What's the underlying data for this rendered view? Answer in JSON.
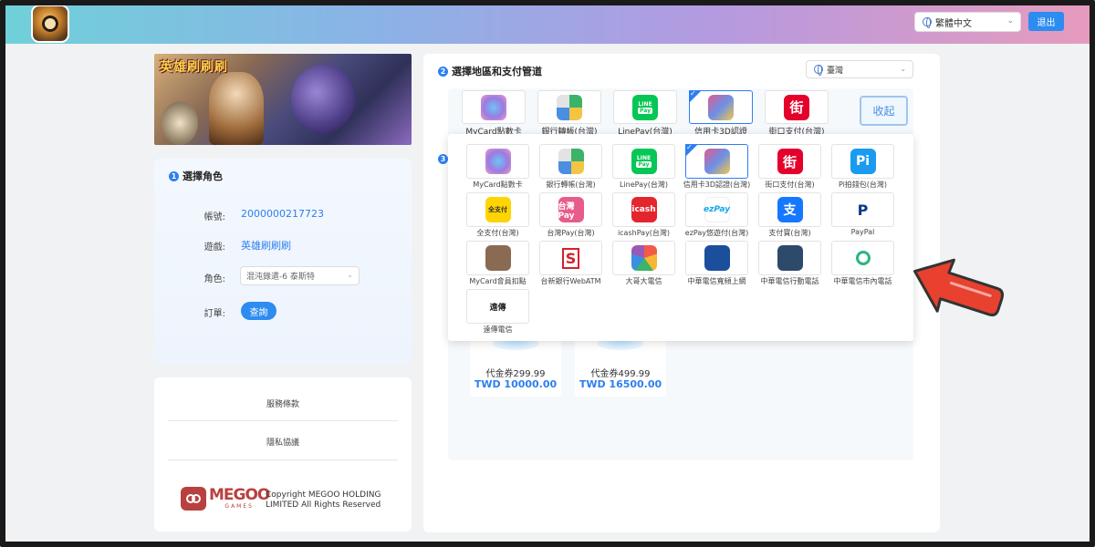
{
  "header": {
    "language": "繁體中文",
    "logout_label": "退出"
  },
  "banner": {
    "title": "英雄刷刷刷"
  },
  "role_section": {
    "step": "1",
    "title": "選擇角色",
    "account_label": "帳號:",
    "account_value": "2000000217723",
    "game_label": "遊戲:",
    "game_value": "英雄刷刷刷",
    "role_label": "角色:",
    "role_value": "混沌錄遣-6 泰斯特",
    "order_label": "訂單:",
    "query_label": "查詢"
  },
  "info": {
    "terms_label": "服務條款",
    "privacy_label": "隱私協議",
    "brand": "MEGOO",
    "brand_sub": "GAMES",
    "copyright": "Copyright MEGOO HOLDING LIMITED All Rights Reserved"
  },
  "payment_section": {
    "step": "2",
    "title": "選擇地區和支付管道",
    "region": "臺灣",
    "collapse_label": "收起",
    "step3": "3",
    "top_row": [
      {
        "label": "MyCard點數卡",
        "icon": "mycard-icon"
      },
      {
        "label": "銀行轉帳(台灣)",
        "icon": "bank-transfer-icon"
      },
      {
        "label": "LinePay(台灣)",
        "icon": "linepay-icon"
      },
      {
        "label": "信用卡3D認證(台灣)",
        "icon": "credit-card-icon",
        "selected": true
      },
      {
        "label": "街口支付(台灣)",
        "icon": "jkopay-icon"
      }
    ],
    "methods": [
      {
        "label": "MyCard點數卡",
        "icon": "mycard-icon"
      },
      {
        "label": "銀行轉帳(台灣)",
        "icon": "bank-transfer-icon"
      },
      {
        "label": "LinePay(台灣)",
        "icon": "linepay-icon"
      },
      {
        "label": "信用卡3D認證(台灣)",
        "icon": "credit-card-icon",
        "selected": true
      },
      {
        "label": "街口支付(台灣)",
        "icon": "jkopay-icon"
      },
      {
        "label": "Pi拍錢包(台灣)",
        "icon": "pi-wallet-icon"
      },
      {
        "label": "全支付(台灣)",
        "icon": "pxpay-icon"
      },
      {
        "label": "台灣Pay(台灣)",
        "icon": "taiwanpay-icon"
      },
      {
        "label": "icashPay(台灣)",
        "icon": "icashpay-icon"
      },
      {
        "label": "ezPay悠遊付(台灣)",
        "icon": "ezpay-icon"
      },
      {
        "label": "支付寶(台灣)",
        "icon": "alipay-icon"
      },
      {
        "label": "PayPal",
        "icon": "paypal-icon"
      },
      {
        "label": "MyCard會員扣點",
        "icon": "mycard-member-icon"
      },
      {
        "label": "台新銀行WebATM",
        "icon": "taishin-bank-icon"
      },
      {
        "label": "大哥大電信",
        "icon": "taiwan-mobile-icon"
      },
      {
        "label": "中華電信寬頻上網",
        "icon": "cht-broadband-icon"
      },
      {
        "label": "中華電信行動電話",
        "icon": "cht-mobile-icon"
      },
      {
        "label": "中華電信市內電話",
        "icon": "cht-landline-icon"
      },
      {
        "label": "遠傳電信",
        "icon": "fareast-telecom-icon"
      }
    ],
    "icon_texts": {
      "line": "LINE",
      "pay": "Pay",
      "jko": "街",
      "pi": "Pi",
      "px": "全支付",
      "twpay": "台灣Pay",
      "icash": "icash",
      "ezpay": "ezPay",
      "fet": "遠傳"
    }
  },
  "products": [
    {
      "name": "代金券299.99",
      "price": "TWD 10000.00"
    },
    {
      "name": "代金券499.99",
      "price": "TWD 16500.00"
    }
  ],
  "colors": {
    "accent": "#2d8cf0",
    "arrow": "#e8412f"
  }
}
